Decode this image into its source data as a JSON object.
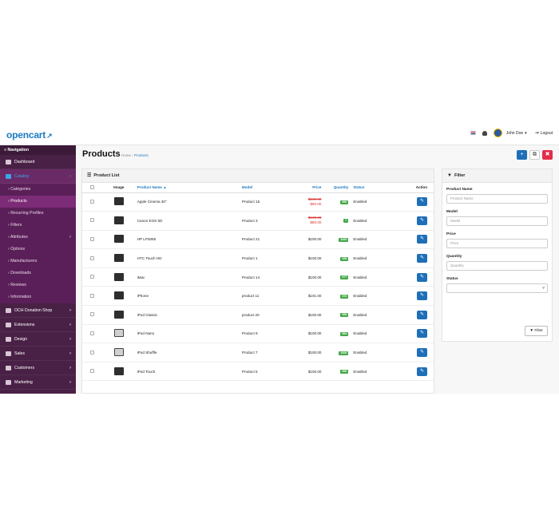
{
  "header": {
    "logo": "opencart",
    "logo_mark": "↗",
    "user_name": "John Doe",
    "caret": "▾",
    "logout_icon": "⇥",
    "logout_label": "Logout"
  },
  "sidebar": {
    "heading": "≡ Navigation",
    "items_top": [
      {
        "label": "Dashboard",
        "icon": "dashboard-icon"
      },
      {
        "label": "Catalog",
        "icon": "tag-icon",
        "active": true
      }
    ],
    "catalog_sub": [
      {
        "label": "Categories"
      },
      {
        "label": "Products",
        "active": true
      },
      {
        "label": "Recurring Profiles"
      },
      {
        "label": "Filters"
      },
      {
        "label": "Attributes",
        "has_children": true
      },
      {
        "label": "Options"
      },
      {
        "label": "Manufacturers"
      },
      {
        "label": "Downloads"
      },
      {
        "label": "Reviews"
      },
      {
        "label": "Information"
      }
    ],
    "items_bottom": [
      {
        "label": "OCH Donation Shop",
        "icon": "heart-icon"
      },
      {
        "label": "Extensions",
        "icon": "puzzle-icon"
      },
      {
        "label": "Design",
        "icon": "monitor-icon"
      },
      {
        "label": "Sales",
        "icon": "cart-icon"
      },
      {
        "label": "Customers",
        "icon": "user-icon"
      },
      {
        "label": "Marketing",
        "icon": "share-icon"
      }
    ],
    "sub_prefix": "›",
    "chevron": "›"
  },
  "page": {
    "title": "Products",
    "breadcrumb_home": "Home",
    "breadcrumb_sep": "›",
    "breadcrumb_current": "Products",
    "add_icon": "+",
    "copy_icon": "⧉",
    "delete_icon": "✖"
  },
  "product_list": {
    "heading": "Product List",
    "heading_icon": "☰",
    "columns": {
      "image": "Image",
      "name": "Product Name ▲",
      "model": "Model",
      "price": "Price",
      "quantity": "Quantity",
      "status": "Status",
      "action": "Action"
    },
    "edit_icon": "✎",
    "rows": [
      {
        "name": "Apple Cinema 30\"",
        "model": "Product 15",
        "price": "$100.00",
        "special": "$90.00",
        "qty": "990",
        "status": "Enabled",
        "thumb": "dark"
      },
      {
        "name": "Canon EOS 5D",
        "model": "Product 3",
        "price": "$100.00",
        "special": "$80.00",
        "qty": "7",
        "status": "Enabled",
        "thumb": "dark"
      },
      {
        "name": "HP LP3065",
        "model": "Product 21",
        "price": "$100.00",
        "special": "",
        "qty": "1000",
        "status": "Enabled",
        "thumb": "dark"
      },
      {
        "name": "HTC Touch HD",
        "model": "Product 1",
        "price": "$100.00",
        "special": "",
        "qty": "939",
        "status": "Enabled",
        "thumb": "dark"
      },
      {
        "name": "iMac",
        "model": "Product 14",
        "price": "$100.00",
        "special": "",
        "qty": "977",
        "status": "Enabled",
        "thumb": "dark"
      },
      {
        "name": "iPhone",
        "model": "product 11",
        "price": "$101.00",
        "special": "",
        "qty": "970",
        "status": "Enabled",
        "thumb": "dark"
      },
      {
        "name": "iPod Classic",
        "model": "product 20",
        "price": "$100.00",
        "special": "",
        "qty": "995",
        "status": "Enabled",
        "thumb": "dark"
      },
      {
        "name": "iPod Nano",
        "model": "Product 9",
        "price": "$100.00",
        "special": "",
        "qty": "994",
        "status": "Enabled",
        "thumb": "light"
      },
      {
        "name": "iPod Shuffle",
        "model": "Product 7",
        "price": "$100.00",
        "special": "",
        "qty": "1000",
        "status": "Enabled",
        "thumb": "light"
      },
      {
        "name": "iPod Touch",
        "model": "Product 5",
        "price": "$100.00",
        "special": "",
        "qty": "996",
        "status": "Enabled",
        "thumb": "dark"
      }
    ]
  },
  "filter": {
    "heading": "Filter",
    "heading_icon": "▼",
    "product_name_label": "Product Name",
    "product_name_placeholder": "Product Name",
    "model_label": "Model",
    "model_placeholder": "Model",
    "price_label": "Price",
    "price_placeholder": "Price",
    "quantity_label": "Quantity",
    "quantity_placeholder": "Quantity",
    "status_label": "Status",
    "status_value": "",
    "select_caret": "˅",
    "button_label": "▼ Filter"
  }
}
